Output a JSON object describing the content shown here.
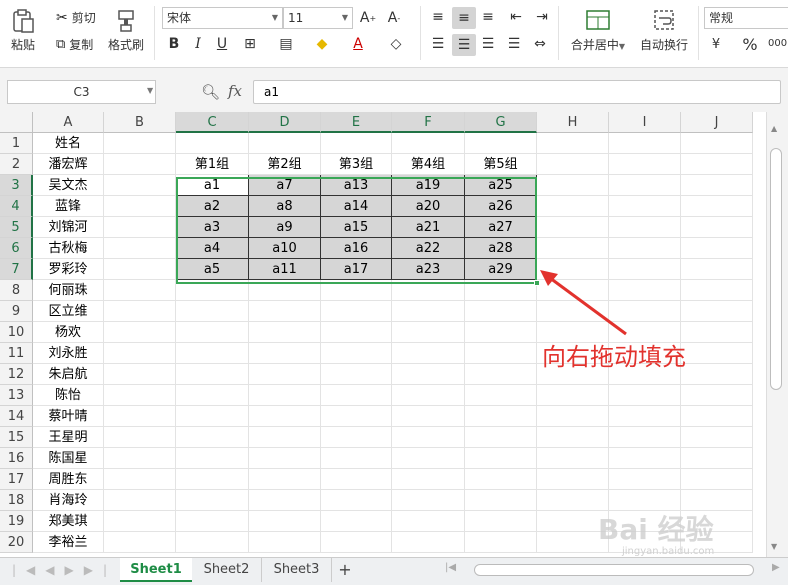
{
  "ribbon": {
    "paste_label": "粘贴",
    "cut_label": "剪切",
    "copy_label": "复制",
    "format_painter_label": "格式刷",
    "font_name": "宋体",
    "font_size": "11",
    "merge_center_label": "合并居中",
    "wrap_text_label": "自动换行",
    "number_format": "常规",
    "percent_symbol": "%",
    "thousands_symbol": "000"
  },
  "formula_bar": {
    "name_box": "C3",
    "fx_label": "fx",
    "formula": "a1"
  },
  "columns": [
    "A",
    "B",
    "C",
    "D",
    "E",
    "F",
    "G",
    "H",
    "I",
    "J"
  ],
  "rows": [
    "1",
    "2",
    "3",
    "4",
    "5",
    "6",
    "7",
    "8",
    "9",
    "10",
    "11",
    "12",
    "13",
    "14",
    "15",
    "16",
    "17",
    "18",
    "19",
    "20"
  ],
  "names": [
    "姓名",
    "潘宏辉",
    "吴文杰",
    "蓝锋",
    "刘锦河",
    "古秋梅",
    "罗彩玲",
    "何丽珠",
    "区立维",
    "杨欢",
    "刘永胜",
    "朱启航",
    "陈怡",
    "蔡叶晴",
    "王星明",
    "陈国星",
    "周胜东",
    "肖海玲",
    "郑美琪",
    "李裕兰"
  ],
  "group_headers": [
    "第1组",
    "第2组",
    "第3组",
    "第4组",
    "第5组"
  ],
  "table": [
    [
      "a1",
      "a7",
      "a13",
      "a19",
      "a25"
    ],
    [
      "a2",
      "a8",
      "a14",
      "a20",
      "a26"
    ],
    [
      "a3",
      "a9",
      "a15",
      "a21",
      "a27"
    ],
    [
      "a4",
      "a10",
      "a16",
      "a22",
      "a28"
    ],
    [
      "a5",
      "a11",
      "a17",
      "a23",
      "a29"
    ]
  ],
  "annotation": "向右拖动填充",
  "sheets": [
    "Sheet1",
    "Sheet2",
    "Sheet3"
  ],
  "add_sheet": "+",
  "watermark": "Bai 经验",
  "watermark_sub": "jingyan.baidu.com",
  "colors": {
    "accent": "#217346",
    "selection_border": "#3aa757",
    "annotation": "#e2322d",
    "shade": "#d6d6d6"
  }
}
